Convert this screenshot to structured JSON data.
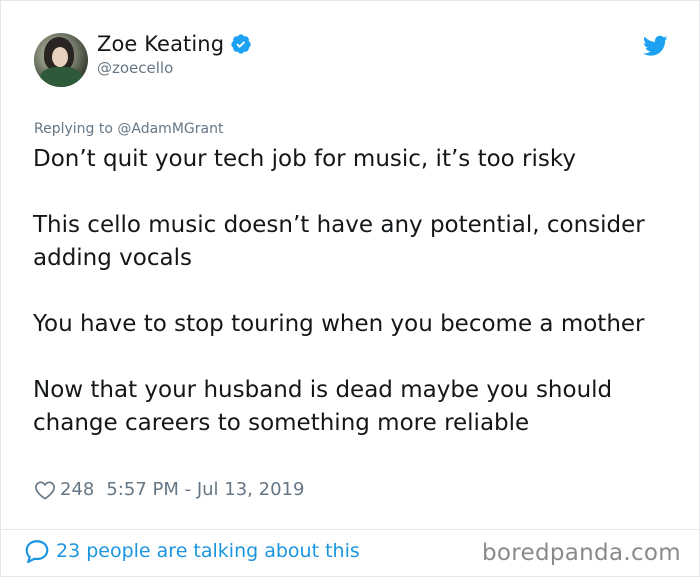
{
  "author": {
    "display_name": "Zoe Keating",
    "handle": "@zoecello",
    "verified": true
  },
  "reply_context": "Replying to @AdamMGrant",
  "tweet_paragraphs": [
    "Don’t quit your tech job for music, it’s too risky",
    "This cello music doesn’t have any potential, consider adding vocals",
    "You have to stop touring when you become a mother",
    "Now that your husband is dead maybe you should change careers to something more reliable"
  ],
  "meta": {
    "likes": "248",
    "timestamp": "5:57 PM - Jul 13, 2019"
  },
  "footer": {
    "talking_label": "23 people are talking about this"
  },
  "watermark": "boredpanda.com",
  "colors": {
    "twitter_blue": "#1da1f2",
    "link_blue": "#1b95e0",
    "muted": "#657786",
    "text": "#14171a"
  },
  "icons": {
    "avatar": "profile-photo",
    "verified": "verified-badge-icon",
    "brand": "twitter-bird-icon",
    "likes": "heart-icon",
    "talking": "speech-bubble-icon"
  }
}
